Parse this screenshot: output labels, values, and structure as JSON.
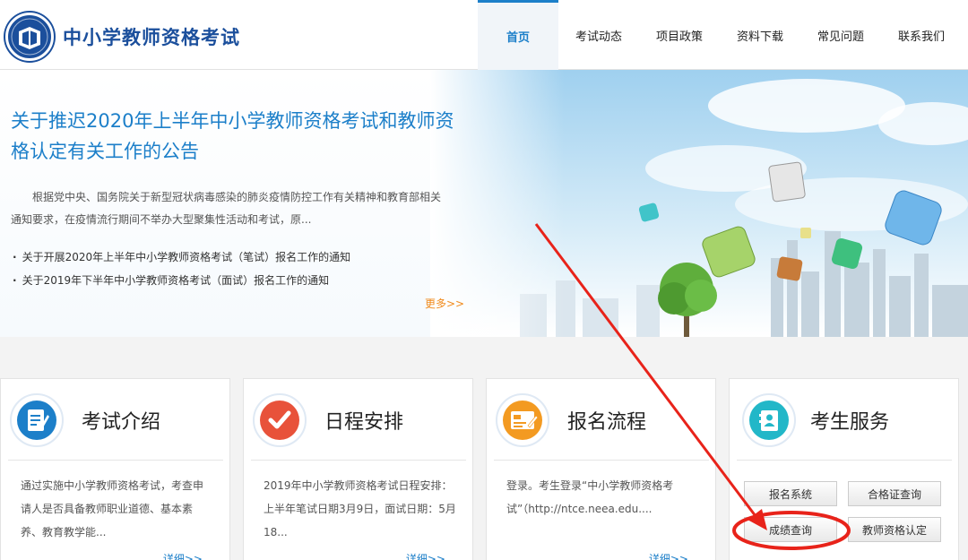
{
  "header": {
    "site_title": "中小学教师资格考试",
    "nav": [
      {
        "label": "首页",
        "active": true
      },
      {
        "label": "考试动态"
      },
      {
        "label": "项目政策"
      },
      {
        "label": "资料下载"
      },
      {
        "label": "常见问题"
      },
      {
        "label": "联系我们"
      }
    ]
  },
  "banner": {
    "headline": "关于推迟2020年上半年中小学教师资格考试和教师资格认定有关工作的公告",
    "summary": "根据党中央、国务院关于新型冠状病毒感染的肺炎疫情防控工作有关精神和教育部相关通知要求，在疫情流行期间不举办大型聚集性活动和考试，原...",
    "notices": [
      "关于开展2020年上半年中小学教师资格考试（笔试）报名工作的通知",
      "关于2019年下半年中小学教师资格考试（面试）报名工作的通知"
    ],
    "more": "更多>>"
  },
  "cards": [
    {
      "title": "考试介绍",
      "icon": "document-pen-icon",
      "text": "通过实施中小学教师资格考试，考查申请人是否具备教师职业道德、基本素养、教育教学能...",
      "more": "详细>>"
    },
    {
      "title": "日程安排",
      "icon": "checkmark-icon",
      "text": "2019年中小学教师资格考试日程安排：上半年笔试日期3月9日，面试日期：5月18...",
      "more": "详细>>"
    },
    {
      "title": "报名流程",
      "icon": "form-edit-icon",
      "text": "登录。考生登录“中小学教师资格考试”（http://ntce.neea.edu....",
      "more": "详细>>"
    },
    {
      "title": "考生服务",
      "icon": "user-card-icon"
    }
  ],
  "services": {
    "buttons": [
      "报名系统",
      "合格证查询",
      "成绩查询",
      "教师资格认定"
    ]
  },
  "colors": {
    "brand": "#1b4f9c",
    "accent": "#1c7fc9",
    "more": "#f08a1c",
    "annotation": "#e8231a"
  }
}
